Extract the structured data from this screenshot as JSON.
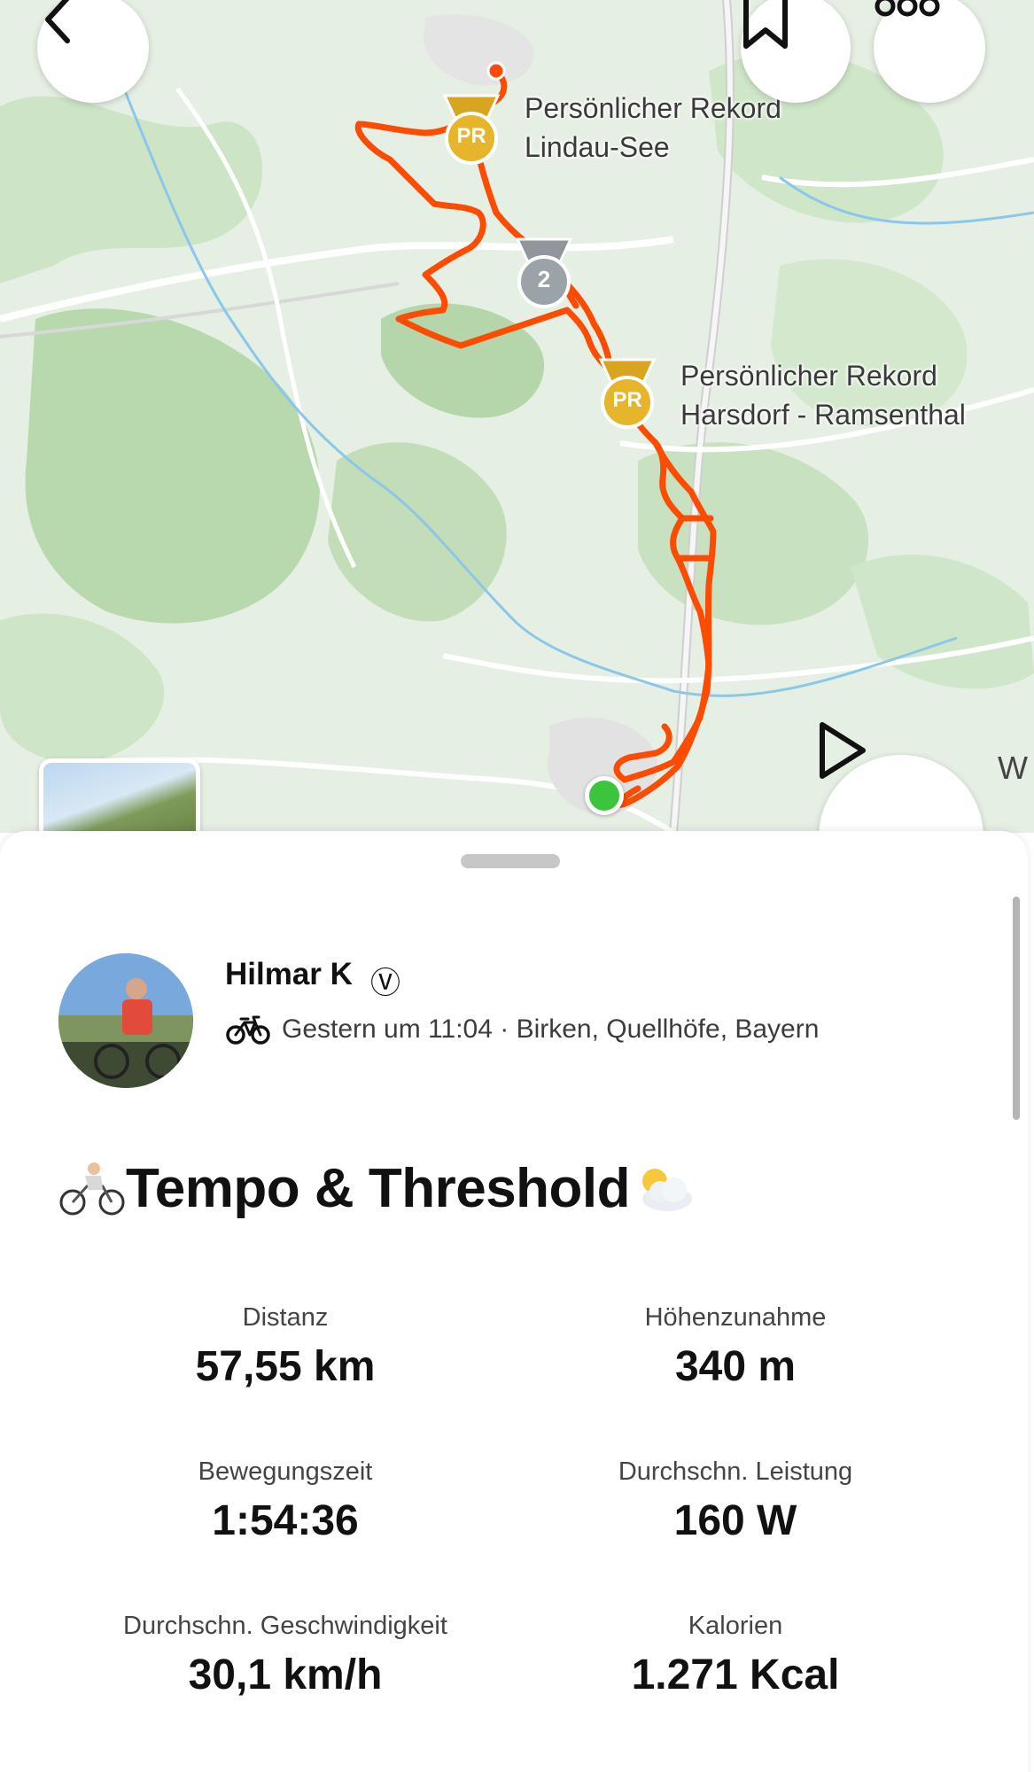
{
  "map": {
    "segments": [
      {
        "line1": "Persönlicher Rekord",
        "line2": "Lindau-See"
      },
      {
        "line1": "Persönlicher Rekord",
        "line2": "Harsdorf - Ramsenthal"
      }
    ],
    "medal_pr_text": "PR",
    "medal_rank_text": "2",
    "edge_label": "W",
    "route_color": "#fc4c02",
    "start_color": "#3cc43c"
  },
  "activity": {
    "athlete_name": "Hilmar K",
    "verified_mark": "Ⓥ",
    "meta": "Gestern um 11:04 · Birken, Quellhöfe, Bayern",
    "title": "Tempo & Threshold",
    "stats": [
      {
        "label": "Distanz",
        "value": "57,55 km"
      },
      {
        "label": "Höhenzunahme",
        "value": "340 m"
      },
      {
        "label": "Bewegungszeit",
        "value": "1:54:36"
      },
      {
        "label": "Durchschn. Leistung",
        "value": "160 W"
      },
      {
        "label": "Durchschn. Geschwindigkeit",
        "value": "30,1 km/h"
      },
      {
        "label": "Kalorien",
        "value": "1.271 Kcal"
      }
    ]
  },
  "icons": {
    "back": "chevron-left-icon",
    "bookmark": "bookmark-icon",
    "more": "more-icon",
    "play": "play-icon",
    "activity_type": "bike-icon",
    "title_prefix": "cyclist-emoji",
    "title_suffix": "sun-behind-cloud-emoji"
  }
}
